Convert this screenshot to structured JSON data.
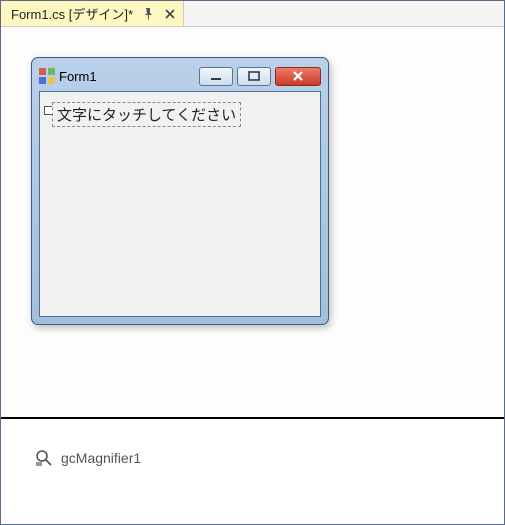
{
  "tab": {
    "label": "Form1.cs [デザイン]*"
  },
  "form": {
    "title": "Form1",
    "label_text": "文字にタッチしてください"
  },
  "tray": {
    "component_name": "gcMagnifier1"
  }
}
